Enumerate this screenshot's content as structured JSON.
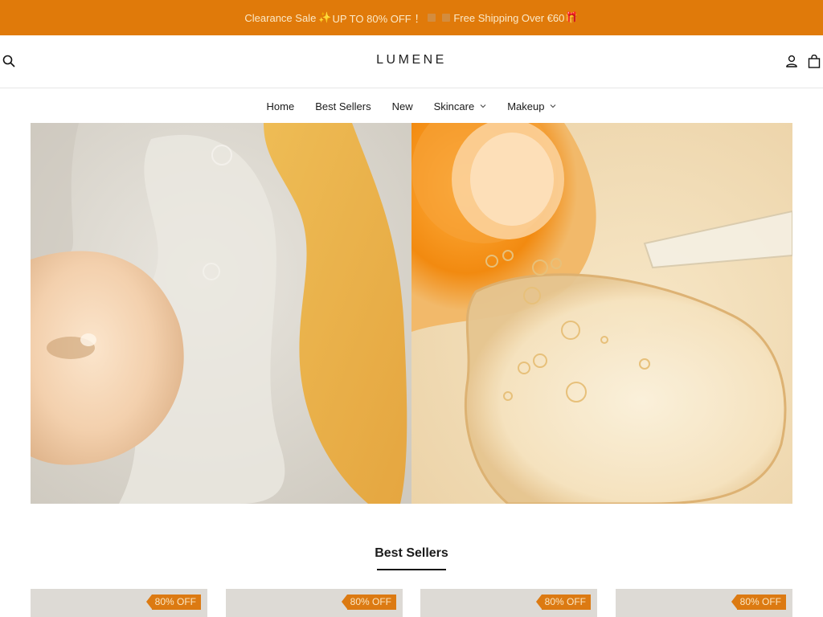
{
  "brand_color": "#e07a0a",
  "announcement": {
    "text_part1": "Clearance Sale ",
    "sparkle": "✨",
    "text_part2": "UP TO 80% OFF ！",
    "text_part3": " Free Shipping Over €60",
    "gift": "🎁"
  },
  "header": {
    "logo": "LUMENE",
    "icons": {
      "search": "search-icon",
      "account": "account-icon",
      "cart": "shopping-bag-icon"
    }
  },
  "nav": {
    "items": [
      {
        "label": "Home",
        "has_dropdown": false
      },
      {
        "label": "Best Sellers",
        "has_dropdown": false
      },
      {
        "label": "New",
        "has_dropdown": false
      },
      {
        "label": "Skincare",
        "has_dropdown": true
      },
      {
        "label": "Makeup",
        "has_dropdown": true
      }
    ]
  },
  "hero": {
    "left_image": "creamy-serum-swatches",
    "right_image": "serum-bottle-and-dropper"
  },
  "best_sellers": {
    "title": "Best Sellers",
    "products": [
      {
        "badge": "80% OFF"
      },
      {
        "badge": "80% OFF"
      },
      {
        "badge": "80% OFF"
      },
      {
        "badge": "80% OFF"
      }
    ]
  }
}
